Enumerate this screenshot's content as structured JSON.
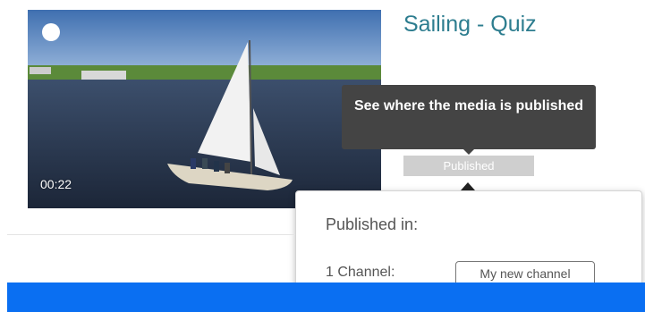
{
  "media": {
    "title": "Sailing - Quiz",
    "duration": "00:22",
    "status_label": "Published"
  },
  "tooltip": {
    "text": "See where the media is published"
  },
  "popover": {
    "heading": "Published in:",
    "channel_count_label": "1 Channel:",
    "channels": [
      "My new channel"
    ]
  },
  "colors": {
    "title": "#2d7d8f",
    "bottom_bar": "#0a6ff2",
    "tooltip_bg": "#444444",
    "badge_bg": "#cfcfcf"
  }
}
